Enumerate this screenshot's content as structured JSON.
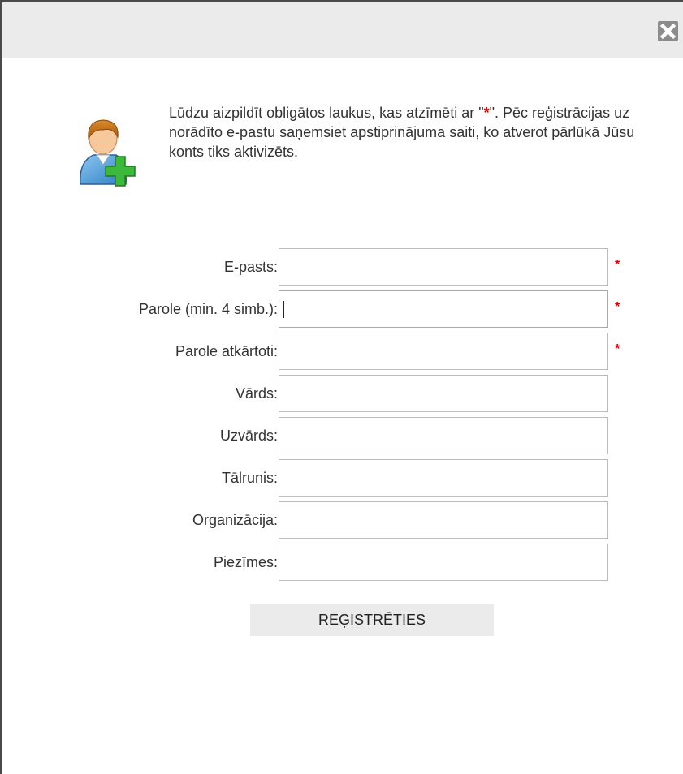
{
  "dialog": {
    "close_label": "×"
  },
  "intro": {
    "line_before_star": "Lūdzu aizpildīt obligātos laukus, kas atzīmēti ar \"",
    "star": "*",
    "line_after_star": "\".",
    "rest": "Pēc reģistrācijas uz norādīto e-pastu saņemsiet apstiprinājuma saiti, ko atverot pārlūkā Jūsu konts tiks aktivizēts."
  },
  "form": {
    "required_marker": "*",
    "fields": {
      "email": {
        "label": "E-pasts:",
        "value": "",
        "required": true
      },
      "password": {
        "label": "Parole (min. 4 simb.):",
        "value": "",
        "required": true,
        "focused": true
      },
      "password_repeat": {
        "label": "Parole atkārtoti:",
        "value": "",
        "required": true
      },
      "first_name": {
        "label": "Vārds:",
        "value": "",
        "required": false
      },
      "last_name": {
        "label": "Uzvārds:",
        "value": "",
        "required": false
      },
      "phone": {
        "label": "Tālrunis:",
        "value": "",
        "required": false
      },
      "organization": {
        "label": "Organizācija:",
        "value": "",
        "required": false
      },
      "notes": {
        "label": "Piezīmes:",
        "value": "",
        "required": false
      }
    },
    "submit_label": "REĢISTRĒTIES"
  },
  "colors": {
    "required": "#e00000",
    "titlebar": "#ebebeb",
    "button_bg": "#ebebeb",
    "close_bg": "#8c8c8c",
    "icon_green": "#3cb93c"
  },
  "icons": {
    "user_add": "add-user-icon",
    "close": "close-icon"
  }
}
